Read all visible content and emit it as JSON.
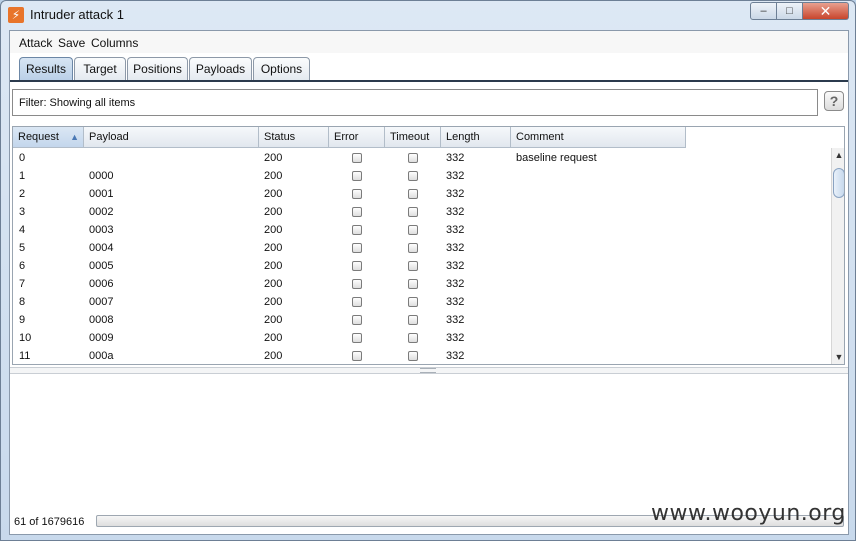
{
  "window": {
    "title": "Intruder attack 1",
    "app_icon": "burp-lightning-icon",
    "controls": {
      "minimize": "–",
      "maximize": "□",
      "close": "✕"
    }
  },
  "menu": [
    "Attack",
    "Save",
    "Columns"
  ],
  "tabs": [
    {
      "label": "Results",
      "active": true
    },
    {
      "label": "Target",
      "active": false
    },
    {
      "label": "Positions",
      "active": false
    },
    {
      "label": "Payloads",
      "active": false
    },
    {
      "label": "Options",
      "active": false
    }
  ],
  "filter": {
    "text": "Filter:  Showing all items",
    "help_label": "?"
  },
  "table": {
    "columns": [
      "Request",
      "Payload",
      "Status",
      "Error",
      "Timeout",
      "Length",
      "Comment"
    ],
    "sort_indicator": "▲",
    "rows": [
      {
        "request": "0",
        "payload": "",
        "status": "200",
        "length": "332",
        "comment": "baseline request"
      },
      {
        "request": "1",
        "payload": "0000",
        "status": "200",
        "length": "332",
        "comment": ""
      },
      {
        "request": "2",
        "payload": "0001",
        "status": "200",
        "length": "332",
        "comment": ""
      },
      {
        "request": "3",
        "payload": "0002",
        "status": "200",
        "length": "332",
        "comment": ""
      },
      {
        "request": "4",
        "payload": "0003",
        "status": "200",
        "length": "332",
        "comment": ""
      },
      {
        "request": "5",
        "payload": "0004",
        "status": "200",
        "length": "332",
        "comment": ""
      },
      {
        "request": "6",
        "payload": "0005",
        "status": "200",
        "length": "332",
        "comment": ""
      },
      {
        "request": "7",
        "payload": "0006",
        "status": "200",
        "length": "332",
        "comment": ""
      },
      {
        "request": "8",
        "payload": "0007",
        "status": "200",
        "length": "332",
        "comment": ""
      },
      {
        "request": "9",
        "payload": "0008",
        "status": "200",
        "length": "332",
        "comment": ""
      },
      {
        "request": "10",
        "payload": "0009",
        "status": "200",
        "length": "332",
        "comment": ""
      },
      {
        "request": "11",
        "payload": "000a",
        "status": "200",
        "length": "332",
        "comment": ""
      }
    ]
  },
  "scroll": {
    "up": "▲",
    "down": "▼"
  },
  "progress": {
    "text": "61 of 1679616",
    "fraction": 4e-05
  },
  "watermark": "www.wooyun.org",
  "colors": {
    "accent": "#b9cfe7",
    "progress": "#4aa34a",
    "app_icon": "#e8742a"
  }
}
